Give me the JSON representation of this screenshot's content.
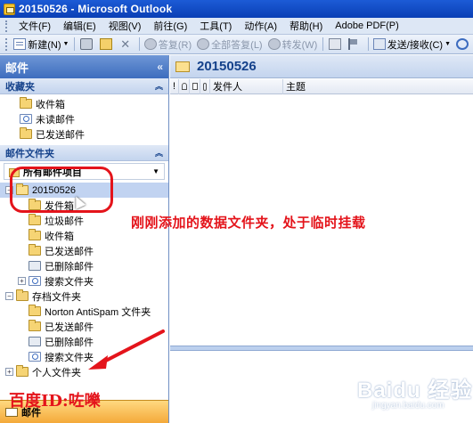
{
  "window": {
    "title": "20150526 - Microsoft Outlook"
  },
  "menu": [
    "文件(F)",
    "编辑(E)",
    "视图(V)",
    "前往(G)",
    "工具(T)",
    "动作(A)",
    "帮助(H)",
    "Adobe PDF(P)"
  ],
  "toolbar": {
    "new_label": "新建(N)",
    "reply_label": "答复(R)",
    "reply_all_label": "全部答复(L)",
    "forward_label": "转发(W)",
    "send_receive_label": "发送/接收(C)"
  },
  "nav": {
    "header": "邮件",
    "collapse_glyph": "«",
    "favorites_header": "收藏夹",
    "favorites": [
      "收件箱",
      "未读邮件",
      "已发送邮件"
    ],
    "mail_folders_header": "邮件文件夹",
    "all_items_label": "所有邮件项目",
    "tree": {
      "data_file": "20150526",
      "data_file_children": [
        "发件箱",
        "垃圾邮件",
        "收件箱",
        "已发送邮件",
        "已删除邮件",
        "搜索文件夹"
      ],
      "archive": "存档文件夹",
      "archive_children": [
        "Norton AntiSpam 文件夹",
        "已发送邮件",
        "已删除邮件",
        "搜索文件夹"
      ],
      "personal": "个人文件夹"
    },
    "bottom_label": "邮件"
  },
  "main": {
    "folder_title": "20150526",
    "columns": [
      "!",
      "发件人",
      "主题"
    ]
  },
  "annotations": {
    "note": "刚刚添加的数据文件夹，处于临时挂载",
    "author_id": "百度ID:咗嚛",
    "watermark_logo": "Baidu 经验",
    "watermark_url": "jingyan.baidu.com"
  },
  "colors": {
    "annotation_red": "#e4141b",
    "title_blue": "#15428b",
    "selection": "#c1d3f1"
  }
}
